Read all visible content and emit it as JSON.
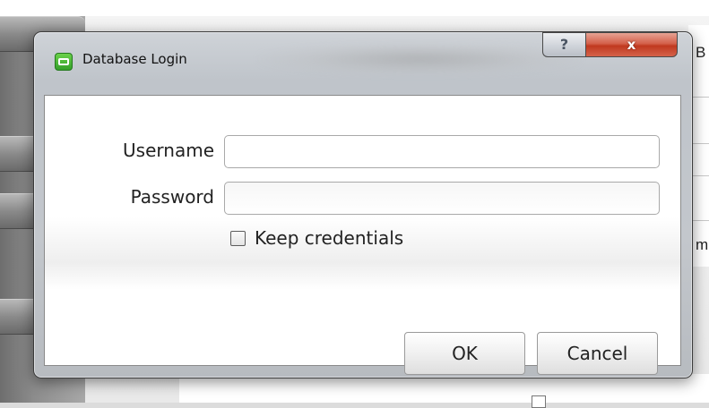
{
  "background": {
    "right_letters": [
      "B",
      "m"
    ]
  },
  "dialog": {
    "title": "Database Login",
    "icon": "app-logo-icon",
    "title_buttons": {
      "help": "?",
      "close": "x"
    },
    "fields": {
      "username_label": "Username",
      "username_value": "",
      "password_label": "Password",
      "password_value": ""
    },
    "keep_credentials": {
      "label": "Keep credentials",
      "checked": false
    },
    "buttons": {
      "ok": "OK",
      "cancel": "Cancel"
    }
  },
  "colors": {
    "close_button": "#c0391f",
    "app_icon": "#34a02a"
  }
}
